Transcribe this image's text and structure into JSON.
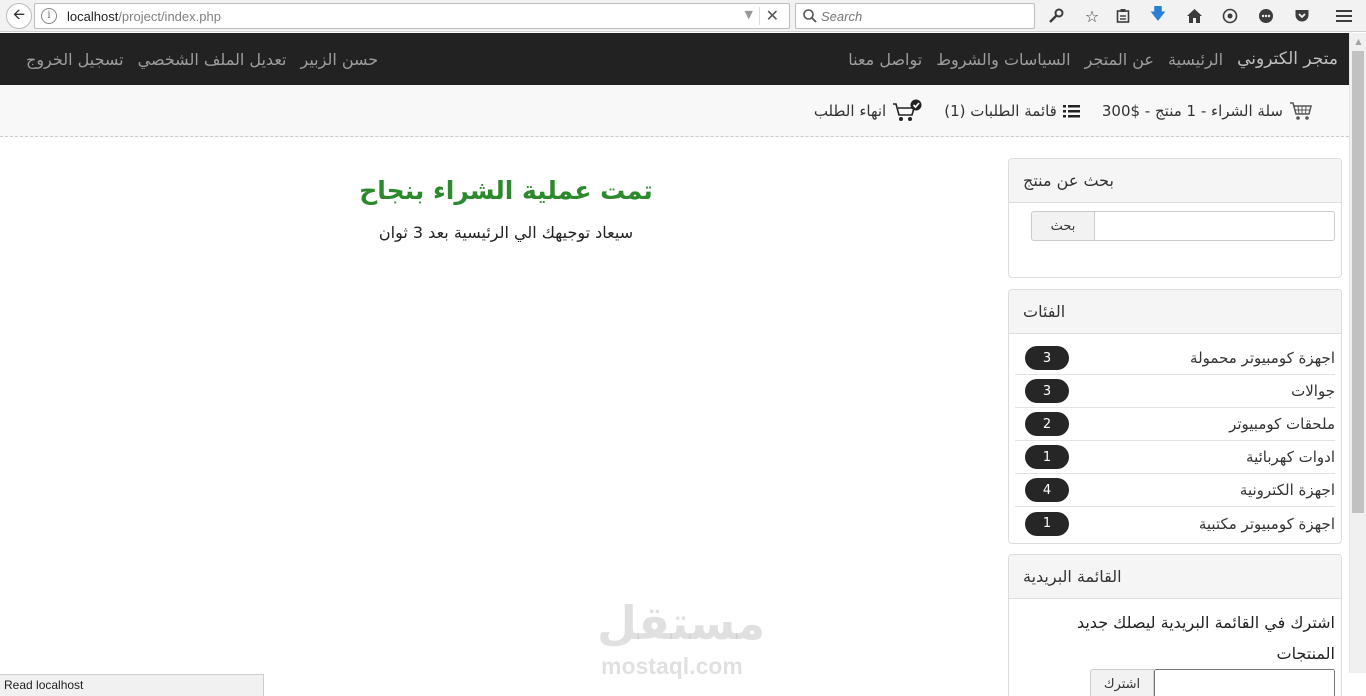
{
  "browser": {
    "url_host": "localhost",
    "url_path": "/project/index.php",
    "search_placeholder": "Search",
    "status_text": "Read localhost"
  },
  "navbar": {
    "brand": "متجر الكتروني",
    "links": [
      "الرئيسية",
      "عن المتجر",
      "السياسات والشروط",
      "تواصل معنا"
    ],
    "user_links": [
      "حسن الزبير",
      "تعديل الملف الشخصي",
      "تسجيل الخروج"
    ]
  },
  "subbar": {
    "cart": "سلة الشراء - 1 منتج - $300",
    "orders": "قائمة الطلبات (1)",
    "checkout": "انهاء الطلب"
  },
  "search_panel": {
    "title": "بحث عن منتج",
    "button": "بحث",
    "placeholder": ""
  },
  "categories_panel": {
    "title": "الفئات",
    "items": [
      {
        "label": "اجهزة كومبيوتر محمولة",
        "count": "3"
      },
      {
        "label": "جوالات",
        "count": "3"
      },
      {
        "label": "ملحقات كومبيوتر",
        "count": "2"
      },
      {
        "label": "ادوات كهربائية",
        "count": "1"
      },
      {
        "label": "اجهزة الكترونية",
        "count": "4"
      },
      {
        "label": "اجهزة كومبيوتر مكتبية",
        "count": "1"
      }
    ]
  },
  "newsletter_panel": {
    "title": "القائمة البريدية",
    "text": "اشترك في القائمة البريدية ليصلك جديد المنتجات",
    "button": "اشترك"
  },
  "main": {
    "success_title": "تمت عملية الشراء بنجاح",
    "redirect_text": "سيعاد توجيهك الي الرئيسية بعد 3 ثوان"
  },
  "watermark": {
    "arabic": "مستقل",
    "latin": "mostaql.com"
  }
}
